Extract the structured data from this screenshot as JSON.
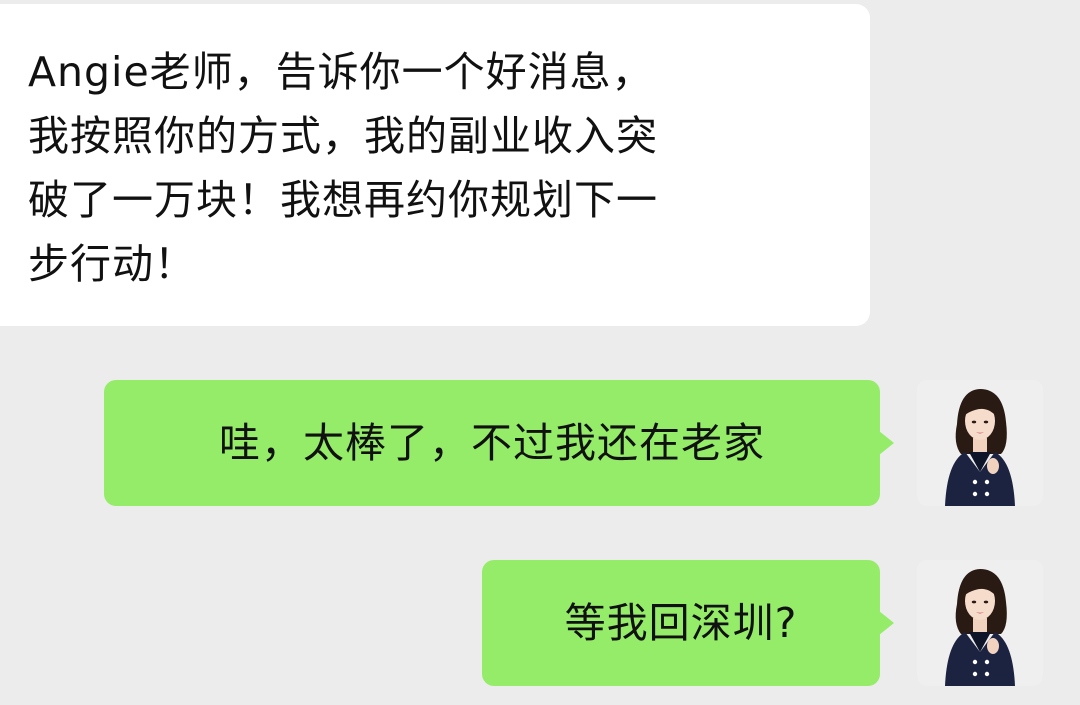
{
  "conversation": {
    "incoming": {
      "text": "Angie老师，告诉你一个好消息，\n我按照你的方式，我的副业收入突\n破了一万块！我想再约你规划下一\n步行动！"
    },
    "outgoing": [
      {
        "text": "哇，太棒了，不过我还在老家"
      },
      {
        "text": "等我回深圳?"
      }
    ]
  },
  "colors": {
    "background": "#ececec",
    "incoming_bubble": "#ffffff",
    "outgoing_bubble": "#95ec69"
  },
  "icons": {
    "sender_avatar": "avatar-icon"
  }
}
